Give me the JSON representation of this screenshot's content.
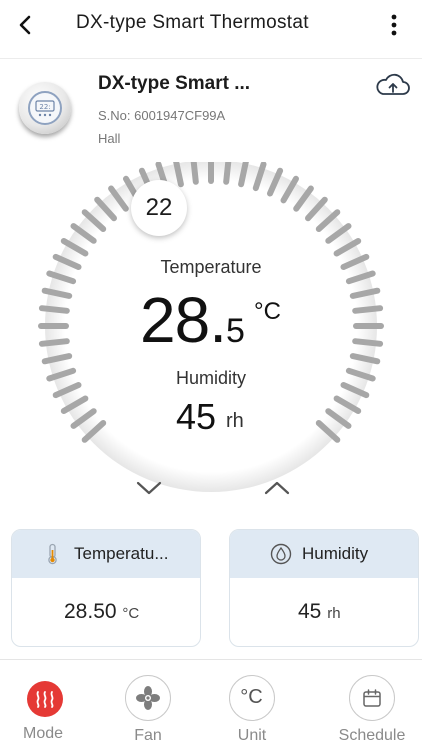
{
  "header": {
    "title": "DX-type Smart Thermostat",
    "back_icon": "chevron-left-icon",
    "more_icon": "more-vertical-icon"
  },
  "device": {
    "name": "DX-type Smart ...",
    "serial": "S.No:  6001947CF99A",
    "location": "Hall",
    "icon": "thermostat-device-icon",
    "cloud_icon": "cloud-upload-icon",
    "display_text": "22:"
  },
  "dial": {
    "setpoint": "22",
    "temperature_label": "Temperature",
    "temperature_int": "28.",
    "temperature_dec": "5",
    "temperature_unit": "°C",
    "humidity_label": "Humidity",
    "humidity_value": "45",
    "humidity_unit": "rh",
    "accent_gray": "#a7a7a7"
  },
  "cards": {
    "temperature": {
      "label": "Temperatu...",
      "value": "28.50",
      "unit": "°C",
      "icon": "thermometer-icon"
    },
    "humidity": {
      "label": "Humidity",
      "value": "45",
      "unit": "rh",
      "icon": "water-drop-icon"
    },
    "header_color": "#dfe9f3"
  },
  "nav": {
    "mode": {
      "label": "Mode",
      "icon": "heat-waves-icon",
      "color": "#e53935"
    },
    "fan": {
      "label": "Fan",
      "icon": "fan-icon"
    },
    "unit": {
      "label": "Unit",
      "icon": "celsius-icon",
      "symbol": "°C"
    },
    "schedule": {
      "label": "Schedule",
      "icon": "calendar-icon"
    }
  }
}
